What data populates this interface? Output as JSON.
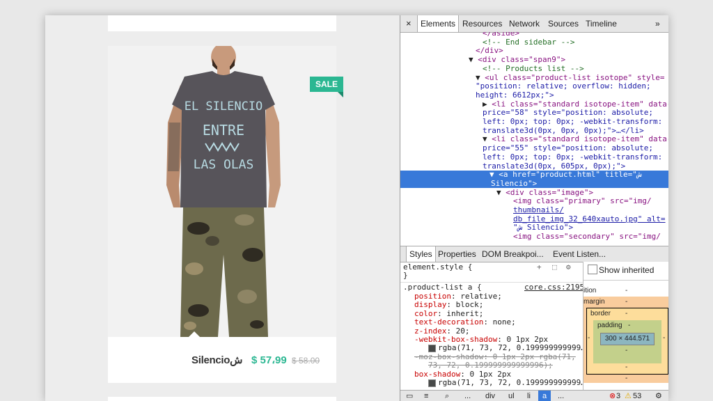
{
  "product": {
    "sale_badge": "SALE",
    "name": "Silencioش",
    "price": "$ 57،99",
    "old_price": "$ 58.00",
    "shirt_lines": [
      "EL SILENCIO",
      "ENTRE",
      "LAS OLAS"
    ]
  },
  "devtools": {
    "close_glyph": "×",
    "tabs": [
      "Elements",
      "Resources",
      "Network",
      "Sources",
      "Timeline"
    ],
    "more_glyph": "»",
    "dom_lines": [
      "</aside>",
      "<!-- End sidebar -->",
      "</div>",
      "<div class=\"span9\">",
      "<!-- Products list -->",
      "<ul class=\"product-list isotope\" style=",
      "\"position: relative; overflow: hidden;",
      "height: 6612px;\">",
      "<li class=\"standard isotope-item\" data-",
      "price=\"58\" style=\"position: absolute;",
      "left: 0px; top: 0px; -webkit-transform:",
      "translate3d(0px, 0px, 0px);\">…</li>",
      "<li class=\"standard isotope-item\" data-",
      "price=\"55\" style=\"position: absolute;",
      "left: 0px; top: 0px; -webkit-transform:",
      "translate3d(0px, 605px, 0px);\">",
      "<a href=\"product.html\" title=\"ش",
      "Silencio\">",
      "<div class=\"image\">",
      "<img class=\"primary\" src=\"img/",
      "thumbnails/",
      "db_file_img_32_640xauto.jpg\" alt=",
      "\"ش Silencio\">",
      "<img class=\"secondary\" src=\"img/"
    ],
    "styles_tabs": [
      "Styles",
      "Properties",
      "DOM Breakpoi...",
      "Event Listen..."
    ],
    "element_style": "element.style {",
    "close_brace": "}",
    "show_inherited": "Show inherited",
    "rule_selector": ".product-list a {",
    "rule_source": "core.css:2195",
    "css_lines": [
      {
        "prop": "position",
        "value": "relative;"
      },
      {
        "prop": "display",
        "value": "block;"
      },
      {
        "prop": "color",
        "value": "inherit;"
      },
      {
        "prop": "text-decoration",
        "value": "none;"
      },
      {
        "prop": "z-index",
        "value": "20;"
      },
      {
        "prop": "-webkit-box-shadow",
        "value": "0 1px 2px"
      },
      {
        "prop": "",
        "value": "rgba(71, 73, 72, 0.199999999999…"
      },
      {
        "prop": "-moz-box-shadow",
        "value": "0 1px 2px rgba(71,"
      },
      {
        "prop": "",
        "value": "73, 72, 0.199999999999996);"
      },
      {
        "prop": "box-shadow",
        "value": "0 1px 2px"
      },
      {
        "prop": "",
        "value": "rgba(71, 73, 72, 0.199999999999…"
      }
    ],
    "box_model": {
      "position_label": "ition",
      "margin_label": "margin",
      "border_label": "border",
      "padding_label": "padding",
      "dash": "-",
      "content": "300 × 444.571"
    },
    "bottom": {
      "crumbs": [
        "div",
        "ul",
        "li",
        "a"
      ],
      "ellipsis": "...",
      "errors": "3",
      "warnings": "53"
    },
    "colors": {
      "selection": "#3879d9",
      "accent": "#2bb792"
    }
  }
}
